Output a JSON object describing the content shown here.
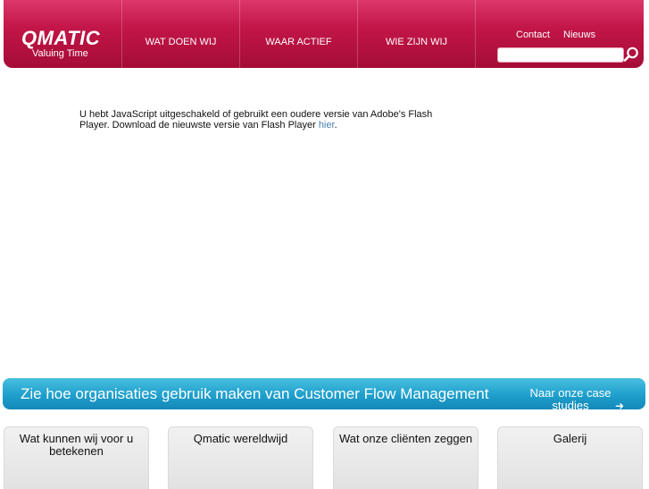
{
  "brand": {
    "name": "QMATIC",
    "tagline": "Valuing Time",
    "color": "#c01546"
  },
  "nav": [
    {
      "label": "WAT DOEN WIJ"
    },
    {
      "label": "WAAR ACTIEF"
    },
    {
      "label": "WIE ZIJN WIJ"
    }
  ],
  "utility": {
    "contact": "Contact",
    "news": "Nieuws"
  },
  "search": {
    "placeholder": "",
    "value": "",
    "icon": "search-icon"
  },
  "message": {
    "text": "U hebt JavaScript uitgeschakeld of gebruikt een oudere versie van Adobe's Flash Player. Download de nieuwste versie van Flash Player ",
    "link": "hier",
    "end": "."
  },
  "banner": {
    "title": "Zie hoe organisaties gebruik maken van Customer Flow Management",
    "link": "Naar onze case studies",
    "arrow": "➜",
    "color": "#1e9fcc"
  },
  "boxes": [
    {
      "label": "Wat kunnen wij voor u betekenen"
    },
    {
      "label": "Qmatic wereldwijd"
    },
    {
      "label": "Wat onze cliënten zeggen"
    },
    {
      "label": "Galerij"
    }
  ]
}
